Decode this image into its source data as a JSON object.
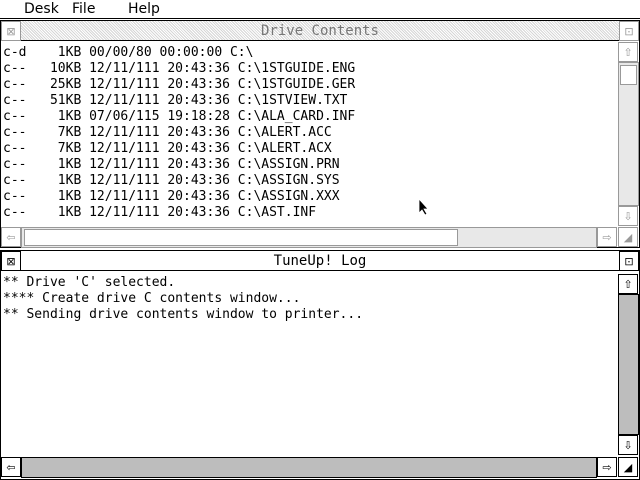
{
  "menu": [
    "Desk",
    "File",
    "Help"
  ],
  "drive_window": {
    "title": "Drive Contents",
    "rows": [
      "c-d    1KB 00/00/80 00:00:00 C:\\",
      "c--   10KB 12/11/111 20:43:36 C:\\1STGUIDE.ENG",
      "c--   25KB 12/11/111 20:43:36 C:\\1STGUIDE.GER",
      "c--   51KB 12/11/111 20:43:36 C:\\1STVIEW.TXT",
      "c--    1KB 07/06/115 19:18:28 C:\\ALA_CARD.INF",
      "c--    7KB 12/11/111 20:43:36 C:\\ALERT.ACC",
      "c--    7KB 12/11/111 20:43:36 C:\\ALERT.ACX",
      "c--    1KB 12/11/111 20:43:36 C:\\ASSIGN.PRN",
      "c--    1KB 12/11/111 20:43:36 C:\\ASSIGN.SYS",
      "c--    1KB 12/11/111 20:43:36 C:\\ASSIGN.XXX",
      "c--    1KB 12/11/111 20:43:36 C:\\AST.INF"
    ]
  },
  "log_window": {
    "title": "TuneUp! Log",
    "lines": [
      "** Drive 'C' selected.",
      "**** Create drive C contents window...",
      "** Sending drive contents window to printer..."
    ]
  },
  "icons": {
    "close": "close-icon",
    "full": "fuller-icon",
    "up": "arrow-up-icon",
    "down": "arrow-down-icon",
    "left": "arrow-left-icon",
    "right": "arrow-right-icon",
    "size": "resize-icon",
    "pointer": "mouse-pointer-icon"
  }
}
